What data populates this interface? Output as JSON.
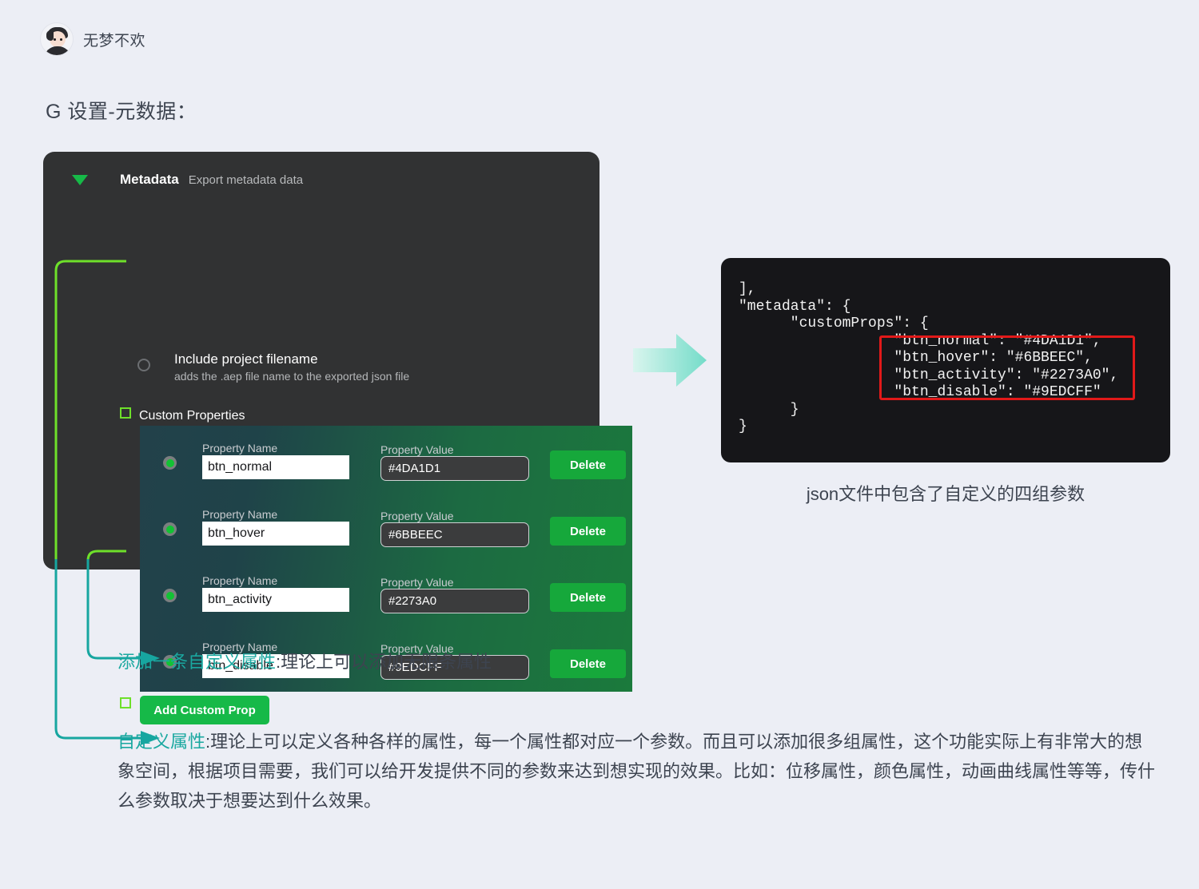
{
  "header": {
    "username": "无梦不欢",
    "avatar_icon": "user-avatar-icon"
  },
  "section_title": "G 设置-元数据：",
  "panel": {
    "caret_icon": "caret-down-icon",
    "title": "Metadata",
    "subtitle": "Export metadata data",
    "include_option": {
      "label": "Include project filename",
      "description": "adds the .aep file name to the exported json file",
      "radio_icon": "radio-unchecked-icon",
      "checked": false
    },
    "custom_properties_label": "Custom Properties",
    "column_labels": {
      "name": "Property Name",
      "value": "Property Value"
    },
    "delete_label": "Delete",
    "add_label": "Add Custom Prop",
    "rows": [
      {
        "name": "btn_normal",
        "value": "#4DA1D1",
        "enabled": true
      },
      {
        "name": "btn_hover",
        "value": "#6BBEEC",
        "enabled": true
      },
      {
        "name": "btn_activity",
        "value": "#2273A0",
        "enabled": true
      },
      {
        "name": "btn_disable",
        "value": "#9EDCFF",
        "enabled": true
      }
    ]
  },
  "flow_arrow_icon": "arrow-right-icon",
  "code_panel": {
    "code": "],\n\"metadata\": {\n      \"customProps\": {\n                  \"btn_normal\": \"#4DA1D1\",\n                  \"btn_hover\": \"#6BBEEC\",\n                  \"btn_activity\": \"#2273A0\",\n                  \"btn_disable\": \"#9EDCFF\"\n      }\n}",
    "highlight_color": "#E11919",
    "caption": "json文件中包含了自定义的四组参数"
  },
  "annotations": [
    {
      "highlight": "添加一条自定义属性",
      "rest": ":理论上可以添加无限条属性"
    },
    {
      "highlight": "自定义属性",
      "rest": ":理论上可以定义各种各样的属性，每一个属性都对应一个参数。而且可以添加很多组属性，这个功能实际上有非常大的想象空间，根据项目需要，我们可以给开发提供不同的参数来达到想实现的效果。比如：位移属性，颜色属性，动画曲线属性等等，传什么参数取决于想要达到什么效果。"
    }
  ],
  "colors": {
    "page_bg": "#ECEEF5",
    "panel_bg": "#313233",
    "code_bg": "#161619",
    "accent_green": "#16B948",
    "accent_teal": "#1AA8A0",
    "connector_green": "#6EE02A",
    "row_gradient_start": "#22414A",
    "row_gradient_end": "#1B7A3C"
  }
}
